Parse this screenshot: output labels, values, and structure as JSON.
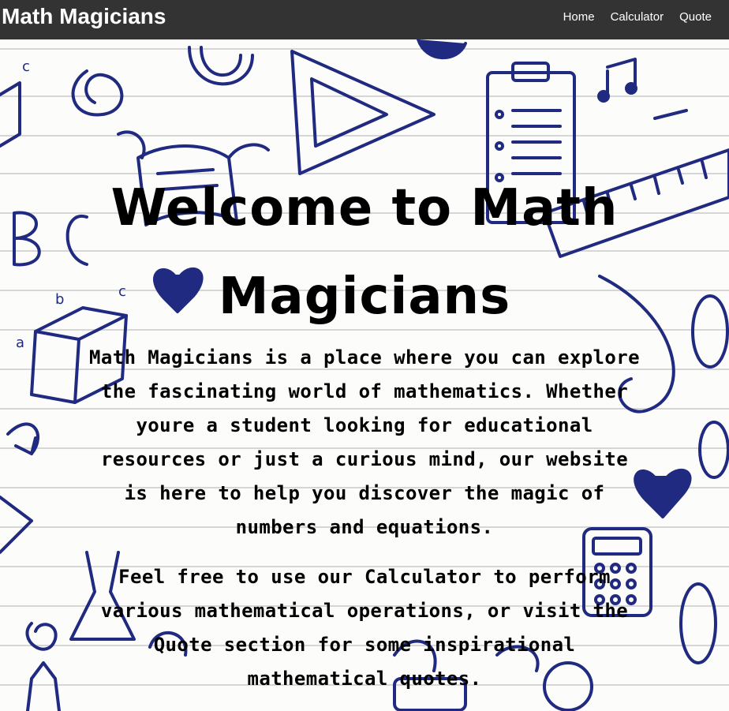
{
  "navbar": {
    "brand": "Math Magicians",
    "links": [
      "Home",
      "Calculator",
      "Quote"
    ]
  },
  "main": {
    "title": "Welcome to Math Magicians",
    "paragraphs": [
      "Math Magicians is a place where you can explore the fascinating world of mathematics. Whether youre a student looking for educational resources or just a curious mind, our website is here to help you discover the magic of numbers and equations.",
      "Feel free to use our Calculator to perform various mathematical operations, or visit the Quote section for some inspirational mathematical quotes."
    ]
  },
  "colors": {
    "navbar_bg": "#333333",
    "doodle_ink": "#1f2a80",
    "paper_line": "#d9d9d9"
  }
}
